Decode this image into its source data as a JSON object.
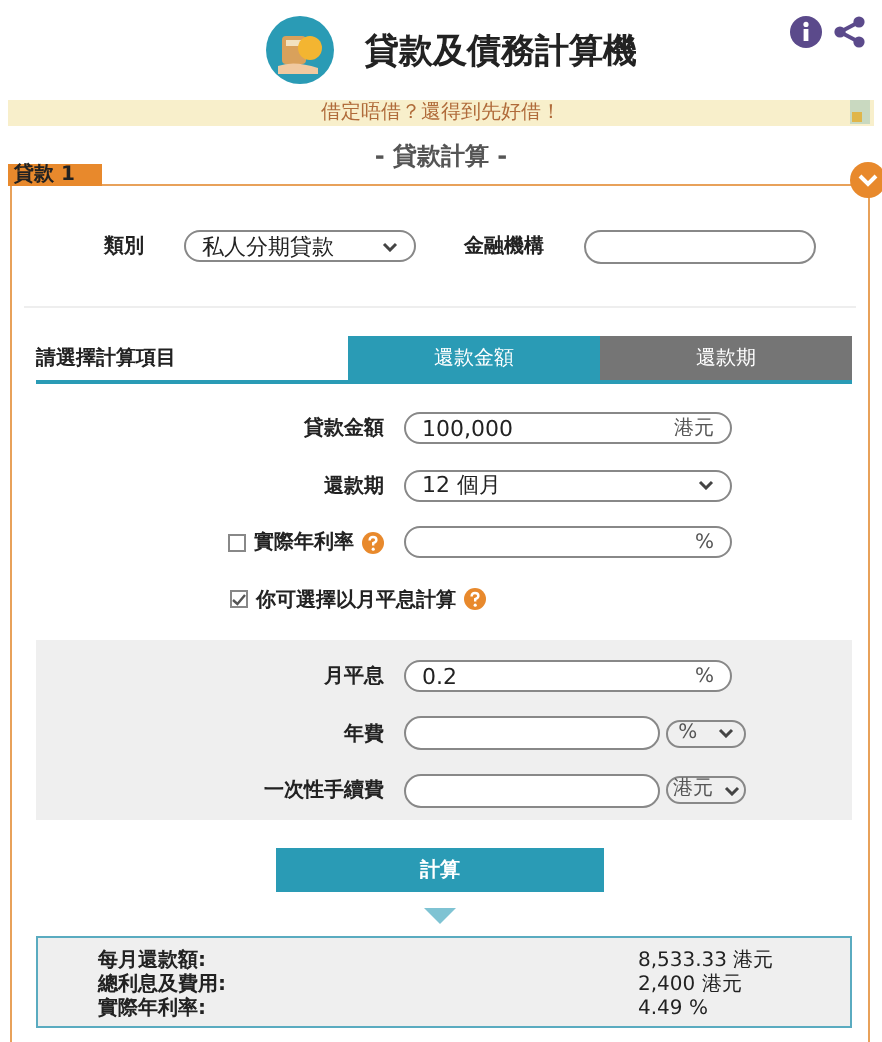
{
  "header": {
    "title": "貸款及債務計算機"
  },
  "banner": {
    "text": "借定唔借？還得到先好借！"
  },
  "section_title": "- 貸款計算 -",
  "loan": {
    "label": "貸款 1",
    "expanded": true,
    "category": {
      "label": "類別",
      "value": "私人分期貸款"
    },
    "institution": {
      "label": "金融機構"
    },
    "calc_prompt": "請選擇計算項目",
    "tabs": [
      {
        "label": "還款金額",
        "selected": true
      },
      {
        "label": "還款期",
        "selected": false
      }
    ],
    "rows": [
      {
        "kind": "input",
        "label": "貸款金額",
        "value": "100,000",
        "unit": "港元"
      },
      {
        "kind": "select",
        "label": "還款期",
        "value": "12 個月"
      },
      {
        "kind": "check",
        "label": "實際年利率",
        "checked": false,
        "help": true,
        "unit": "%"
      },
      {
        "kind": "checkonly",
        "label": "你可選擇以月平息計算",
        "checked": true,
        "help": true
      }
    ],
    "flat_rows": [
      {
        "kind": "input",
        "label": "月平息",
        "value": "0.2",
        "unit": "%"
      },
      {
        "kind": "unitselect",
        "label": "年費",
        "unit": "%"
      },
      {
        "kind": "unitselect",
        "label": "一次性手續費",
        "unit": "港元"
      }
    ],
    "button": "計算",
    "results": [
      {
        "label": "每月還款額:",
        "value": "8,533.33 港元"
      },
      {
        "label": "總利息及費用:",
        "value": "2,400 港元"
      },
      {
        "label": "實際年利率:",
        "value": "4.49 %"
      }
    ]
  }
}
